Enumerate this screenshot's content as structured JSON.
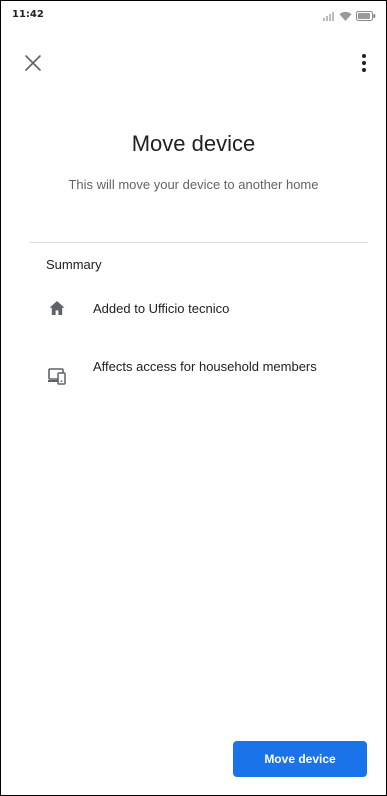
{
  "status_bar": {
    "time": "11:42",
    "battery_level": "85",
    "signal_icon": "signal-icon",
    "wifi_icon": "wifi-icon",
    "battery_icon": "battery-icon"
  },
  "app_bar": {
    "close_icon": "close-icon",
    "more_icon": "more-vert-icon"
  },
  "main": {
    "title": "Move device",
    "subtitle": "This will move your device to another home",
    "summary_heading": "Summary",
    "items": [
      {
        "icon": "home-icon",
        "label": "Added to Ufficio tecnico"
      },
      {
        "icon": "devices-icon",
        "label": "Affects access for household members"
      }
    ]
  },
  "footer": {
    "primary_button_label": "Move device"
  },
  "colors": {
    "accent": "#1a73e8",
    "text_primary": "#202124",
    "text_secondary": "#5f6368",
    "divider": "#dadce0"
  }
}
